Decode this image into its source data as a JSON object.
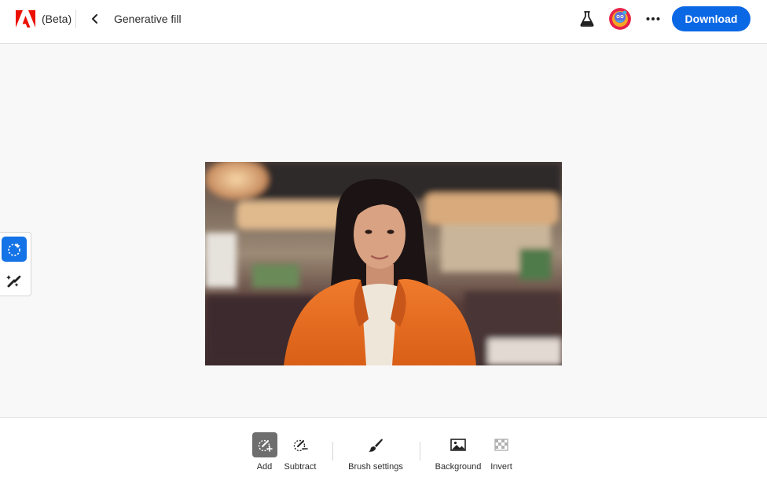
{
  "header": {
    "beta_label": "(Beta)",
    "page_title": "Generative fill",
    "download_label": "Download",
    "icons": {
      "logo": "adobe-logo",
      "back": "chevron-left-icon",
      "labs": "flask-icon",
      "avatar": "user-avatar",
      "more": "more-horizontal-icon"
    }
  },
  "tool_rail": {
    "tools": [
      {
        "icon": "sparkle-lasso-icon",
        "active": true
      },
      {
        "icon": "brush-remove-icon",
        "active": false
      }
    ]
  },
  "toolbar": {
    "add_label": "Add",
    "subtract_label": "Subtract",
    "brush_settings_label": "Brush settings",
    "background_label": "Background",
    "invert_label": "Invert"
  },
  "colors": {
    "accent": "#0b68e5",
    "active_tool": "#1473e6",
    "toolbar_active": "#6e6e6e",
    "canvas_bg": "#f8f8f8"
  }
}
